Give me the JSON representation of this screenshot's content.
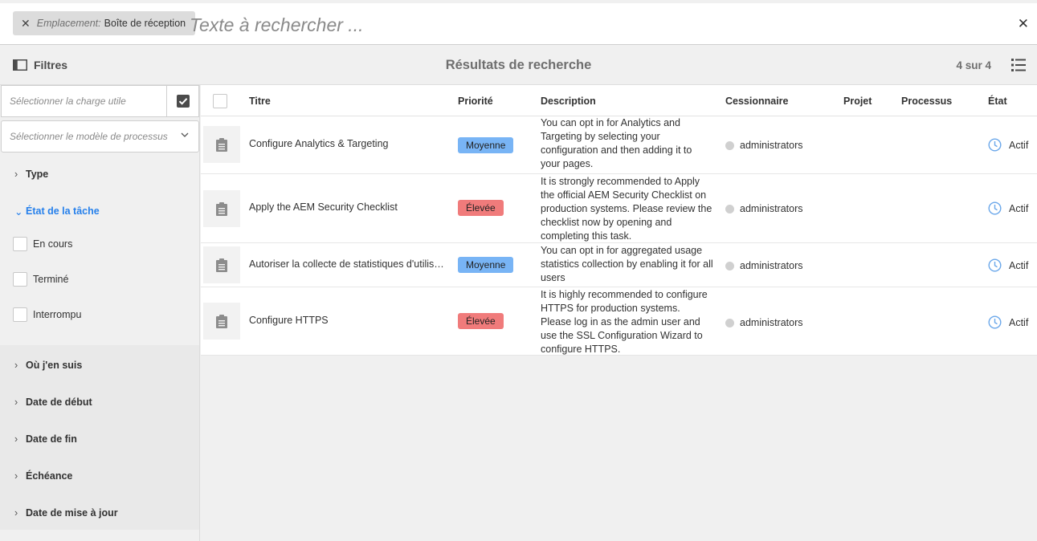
{
  "search": {
    "location_label": "Emplacement:",
    "location_value": "Boîte de réception",
    "placeholder": "Texte à rechercher ..."
  },
  "header": {
    "filters_label": "Filtres",
    "title": "Résultats de recherche",
    "count": "4 sur 4"
  },
  "sidebar": {
    "payload_placeholder": "Sélectionner la charge utile",
    "model_placeholder": "Sélectionner le modèle de processus",
    "sections": [
      "Type",
      "État de la tâche",
      "Où j'en suis",
      "Date de début",
      "Date de fin",
      "Échéance",
      "Date de mise à jour"
    ],
    "status_options": [
      "En cours",
      "Terminé",
      "Interrompu"
    ]
  },
  "table": {
    "columns": [
      "Titre",
      "Priorité",
      "Description",
      "Cessionnaire",
      "Projet",
      "Processus",
      "État"
    ],
    "rows": [
      {
        "title": "Configure Analytics & Targeting",
        "priority": "Moyenne",
        "description": "You can opt in for Analytics and Targeting by selecting your configuration and then adding it to your pages.",
        "assignee": "administrators",
        "status": "Actif"
      },
      {
        "title": "Apply the AEM Security Checklist",
        "priority": "Élevée",
        "description": "It is strongly recommended to Apply the official AEM Security Checklist on production systems. Please review the checklist now by opening and completing this task.",
        "assignee": "administrators",
        "status": "Actif"
      },
      {
        "title": "Autoriser la collecte de statistiques d'utilisation",
        "priority": "Moyenne",
        "description": "You can opt in for aggregated usage statistics collection by enabling it for all users",
        "assignee": "administrators",
        "status": "Actif"
      },
      {
        "title": "Configure HTTPS",
        "priority": "Élevée",
        "description": "It is highly recommended to configure HTTPS for production systems. Please log in as the admin user and use the SSL Configuration Wizard to configure HTTPS.",
        "assignee": "administrators",
        "status": "Actif"
      }
    ]
  },
  "colors": {
    "priority_medium": "#78b4f5",
    "priority_high": "#f07b7b",
    "accent": "#2680eb"
  },
  "icons": [
    "close-icon",
    "filter-panel-icon",
    "list-view-icon",
    "checkmark-icon",
    "chevron-down-icon",
    "task-clipboard-icon",
    "clock-icon"
  ]
}
